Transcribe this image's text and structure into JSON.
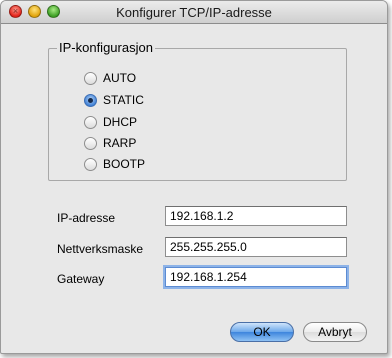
{
  "window": {
    "title": "Konfigurer TCP/IP-adresse"
  },
  "ip_config": {
    "label": "IP-konfigurasjon",
    "selected": "STATIC",
    "options": [
      "AUTO",
      "STATIC",
      "DHCP",
      "RARP",
      "BOOTP"
    ]
  },
  "fields": {
    "ip_address": {
      "label": "IP-adresse",
      "value": "192.168.1.2"
    },
    "subnet_mask": {
      "label": "Nettverksmaske",
      "value": "255.255.255.0"
    },
    "gateway": {
      "label": "Gateway",
      "value": "192.168.1.254"
    }
  },
  "buttons": {
    "ok": "OK",
    "cancel": "Avbryt"
  }
}
